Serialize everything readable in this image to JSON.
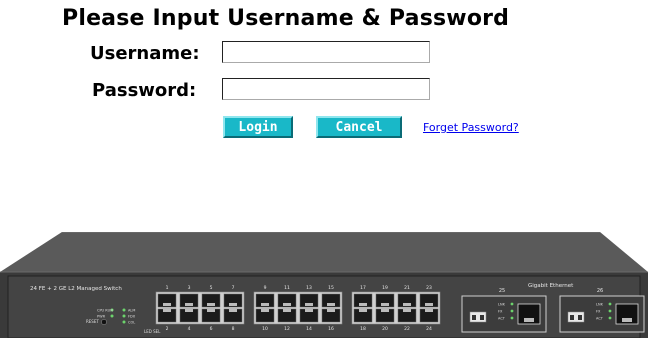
{
  "login": {
    "title": "Please Input Username & Password",
    "username_label": "Username:",
    "username_value": "",
    "password_label": "Password:",
    "password_value": "",
    "login_button": "Login",
    "cancel_button": "Cancel",
    "forget_link": "Forget Password?"
  },
  "device": {
    "model_label": "24 FE + 2 GE L2 Managed Switch",
    "gigabit_label": "Gigabit Ethernet",
    "reset_label": "RESET",
    "led_labels": [
      "CPU RUN",
      "PWR",
      "ALM",
      "FDX",
      "COL"
    ],
    "led_sel_label": "LED SEL",
    "port_numbers_top": [
      "1",
      "3",
      "5",
      "7",
      "9",
      "11",
      "13",
      "15",
      "17",
      "19",
      "21",
      "23"
    ],
    "port_numbers_bottom": [
      "2",
      "4",
      "6",
      "8",
      "10",
      "12",
      "14",
      "16",
      "18",
      "20",
      "22",
      "24"
    ],
    "gig_ports": [
      "25",
      "26"
    ],
    "gig_led_labels": [
      "LNK",
      "FX",
      "ACT"
    ]
  },
  "colors": {
    "button_bg": "#19b8c8",
    "button_text": "#ffffff",
    "link": "#0000ee",
    "chassis": "#3f3f3f",
    "chassis_top": "#5a5a5a"
  }
}
